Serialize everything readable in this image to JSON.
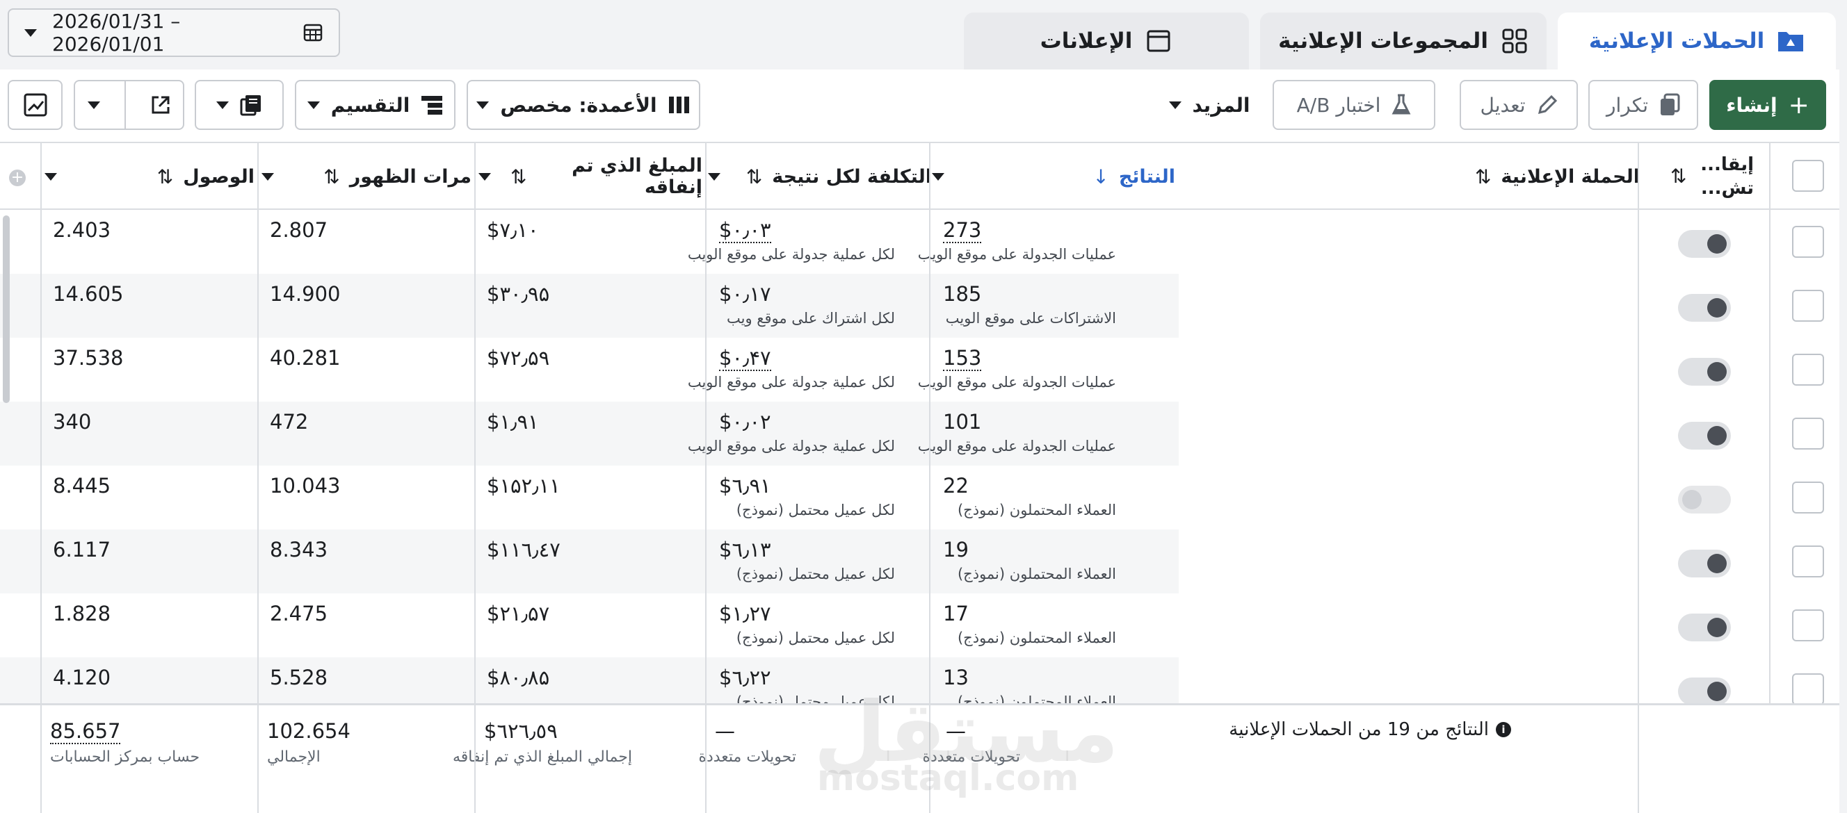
{
  "date_range": "2026/01/31 – 2026/01/01",
  "tabs": [
    {
      "label": "الحملات الإعلانية",
      "icon": "folder-icon"
    },
    {
      "label": "المجموعات الإعلانية",
      "icon": "grid-icon"
    },
    {
      "label": "الإعلانات",
      "icon": "ad-window-icon"
    }
  ],
  "toolbar": {
    "create": "إنشاء",
    "duplicate": "تكرار",
    "edit": "تعديل",
    "ab_test": "اختبار A/B",
    "more": "المزيد",
    "columns": "الأعمدة: مخصص",
    "breakdown": "التقسيم"
  },
  "columns": {
    "status": "إيقا... تش...",
    "campaign": "الحملة الإعلانية",
    "results": "النتائج",
    "cost_per_result": "التكلفة لكل نتيجة",
    "amount_spent": "المبلغ الذي تم إنفاقه",
    "impressions": "مرات الظهور",
    "reach": "الوصول"
  },
  "rows": [
    {
      "results": "273",
      "results_sub": "عمليات الجدولة على موقع الويب",
      "cost": "$۰٫۰۳",
      "cost_sub": "لكل عملية جدولة على موقع الويب",
      "spent": "$۷٫۱۰",
      "impressions": "2.807",
      "reach": "2.403",
      "toggle": "on"
    },
    {
      "results": "185",
      "results_sub": "الاشتراكات على موقع الويب",
      "cost": "$۰٫۱۷",
      "cost_sub": "لكل اشتراك على موقع ويب",
      "spent": "$۳۰٫۹۵",
      "impressions": "14.900",
      "reach": "14.605",
      "toggle": "on"
    },
    {
      "results": "153",
      "results_sub": "عمليات الجدولة على موقع الويب",
      "cost": "$۰٫۴۷",
      "cost_sub": "لكل عملية جدولة على موقع الويب",
      "spent": "$۷۲٫۵۹",
      "impressions": "40.281",
      "reach": "37.538",
      "toggle": "on"
    },
    {
      "results": "101",
      "results_sub": "عمليات الجدولة على موقع الويب",
      "cost": "$۰٫۰۲",
      "cost_sub": "لكل عملية جدولة على موقع الويب",
      "spent": "$۱٫۹۱",
      "impressions": "472",
      "reach": "340",
      "toggle": "on"
    },
    {
      "results": "22",
      "results_sub": "العملاء المحتملون (نموذج)",
      "cost": "$٦٫۹۱",
      "cost_sub": "لكل عميل محتمل (نموذج)",
      "spent": "$۱۵۲٫۱۱",
      "impressions": "10.043",
      "reach": "8.445",
      "toggle": "off"
    },
    {
      "results": "19",
      "results_sub": "العملاء المحتملون (نموذج)",
      "cost": "$٦٫۱۳",
      "cost_sub": "لكل عميل محتمل (نموذج)",
      "spent": "$۱۱٦٫٤۷",
      "impressions": "8.343",
      "reach": "6.117",
      "toggle": "on"
    },
    {
      "results": "17",
      "results_sub": "العملاء المحتملون (نموذج)",
      "cost": "$۱٫۲۷",
      "cost_sub": "لكل عميل محتمل (نموذج)",
      "spent": "$۲۱٫۵۷",
      "impressions": "2.475",
      "reach": "1.828",
      "toggle": "on"
    },
    {
      "results": "13",
      "results_sub": "العملاء المحتملون (نموذج)",
      "cost": "$٦٫۲۲",
      "cost_sub": "لكل عميل محتمل (نموذج)",
      "spent": "$۸۰٫۸۵",
      "impressions": "5.528",
      "reach": "4.120",
      "toggle": "on"
    }
  ],
  "footer": {
    "summary": "النتائج من 19 من الحملات الإعلانية",
    "results": "—",
    "results_sub": "تحويلات متعددة",
    "cost": "—",
    "cost_sub": "تحويلات متعددة",
    "spent": "$٦۲٦٫٥۹",
    "spent_sub": "إجمالي المبلغ الذي تم إنفاقه",
    "impressions": "102.654",
    "impressions_sub": "الإجمالي",
    "reach": "85.657",
    "reach_sub": "حساب بمركز الحسابات"
  },
  "watermark": "مستقل",
  "watermark_url": "mostaql.com",
  "colors": {
    "accent": "#2d66c8",
    "primary_button": "#2f6b47"
  }
}
